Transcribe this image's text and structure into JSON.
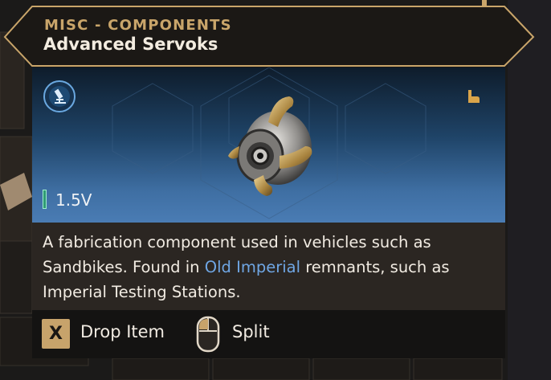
{
  "tooltip": {
    "category": "MISC - COMPONENTS",
    "item_name": "Advanced Servoks",
    "volume": "1.5V",
    "description": {
      "before": "A fabrication component used in vehicles such as Sandbikes. Found in ",
      "highlight": "Old Imperial",
      "after": " remnants, such as Imperial Testing Stations."
    },
    "actions": {
      "drop_key": "X",
      "drop_label": "Drop Item",
      "split_label": "Split"
    }
  },
  "icons": {
    "research": "research-microscope-icon",
    "hand": "hand-pointer-icon",
    "mouse": "mouse-icon",
    "item": "servok-component-image"
  },
  "colors": {
    "accent_gold": "#c9a56a",
    "highlight_blue": "#6fa6e4",
    "volume_green": "#2f9a74"
  }
}
